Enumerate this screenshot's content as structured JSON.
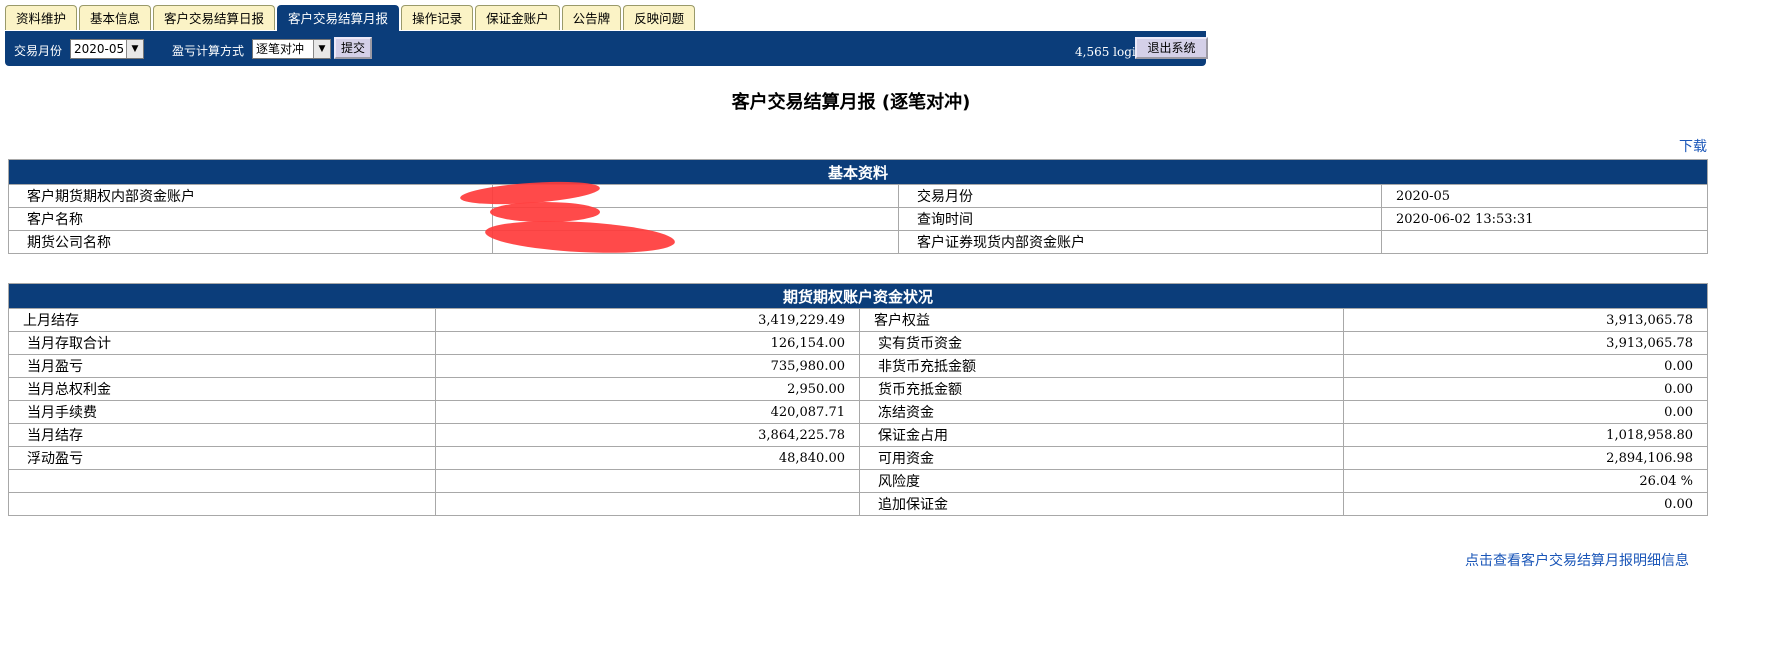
{
  "tabs": [
    {
      "label": "资料维护",
      "active": false
    },
    {
      "label": "基本信息",
      "active": false
    },
    {
      "label": "客户交易结算日报",
      "active": false
    },
    {
      "label": "客户交易结算月报",
      "active": true
    },
    {
      "label": "操作记录",
      "active": false
    },
    {
      "label": "保证金账户",
      "active": false
    },
    {
      "label": "公告牌",
      "active": false
    },
    {
      "label": "反映问题",
      "active": false
    }
  ],
  "toolbar": {
    "month_label": "交易月份",
    "month_value": "2020-05",
    "method_label": "盈亏计算方式",
    "method_value": "逐笔对冲",
    "submit_label": "提交",
    "login_info": "4,565 login",
    "logout_label": "退出系统"
  },
  "page": {
    "title": "客户交易结算月报 (逐笔对冲)",
    "download_link": "下载",
    "detail_link": "点击查看客户交易结算月报明细信息"
  },
  "basic_info": {
    "header": "基本资料",
    "rows": [
      {
        "l_label": "客户期货期权内部资金账户",
        "l_value": "",
        "r_label": "交易月份",
        "r_value": "2020-05"
      },
      {
        "l_label": "客户名称",
        "l_value": "",
        "r_label": "查询时间",
        "r_value": "2020-06-02 13:53:31"
      },
      {
        "l_label": "期货公司名称",
        "l_value": "",
        "r_label": "客户证券现货内部资金账户",
        "r_value": ""
      }
    ]
  },
  "account_status": {
    "header": "期货期权账户资金状况",
    "rows": [
      {
        "l_label": "上月结存",
        "l_value": "3,419,229.49",
        "r_label": "客户权益",
        "r_value": "3,913,065.78"
      },
      {
        "l_label": "当月存取合计",
        "l_value": "126,154.00",
        "r_label": "实有货币资金",
        "r_value": "3,913,065.78"
      },
      {
        "l_label": "当月盈亏",
        "l_value": "735,980.00",
        "r_label": "非货币充抵金额",
        "r_value": "0.00"
      },
      {
        "l_label": "当月总权利金",
        "l_value": "2,950.00",
        "r_label": "货币充抵金额",
        "r_value": "0.00"
      },
      {
        "l_label": "当月手续费",
        "l_value": "420,087.71",
        "r_label": "冻结资金",
        "r_value": "0.00"
      },
      {
        "l_label": "当月结存",
        "l_value": "3,864,225.78",
        "r_label": "保证金占用",
        "r_value": "1,018,958.80"
      },
      {
        "l_label": "浮动盈亏",
        "l_value": "48,840.00",
        "r_label": "可用资金",
        "r_value": "2,894,106.98"
      },
      {
        "l_label": "",
        "l_value": "",
        "r_label": "风险度",
        "r_value": "26.04 %"
      },
      {
        "l_label": "",
        "l_value": "",
        "r_label": "追加保证金",
        "r_value": "0.00"
      }
    ]
  },
  "colors": {
    "accent": "#0b3d7a",
    "tab_bg": "#fbf3c6",
    "link": "#1a56b8",
    "redaction": "#ff3b3b"
  }
}
